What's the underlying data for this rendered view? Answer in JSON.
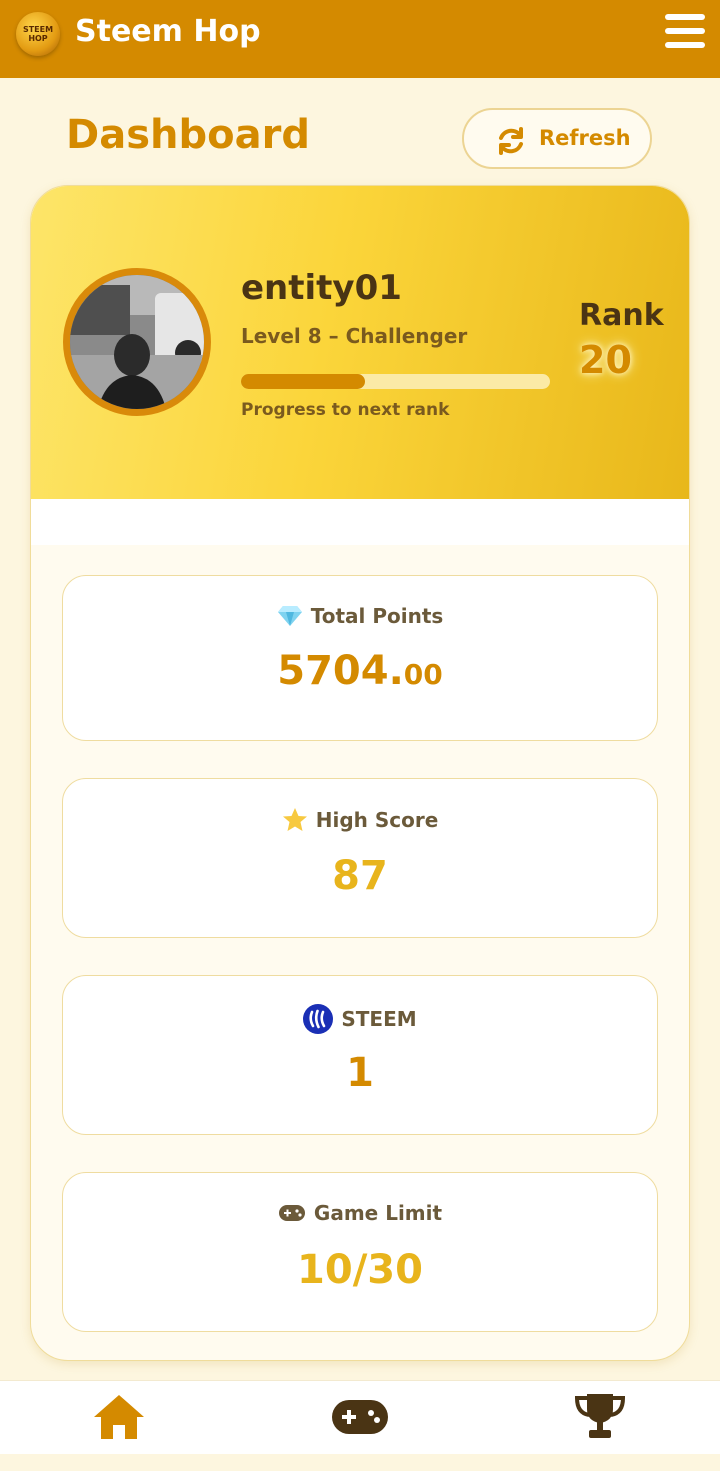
{
  "app": {
    "title": "Steem Hop",
    "logo_text": [
      "STEEM",
      "HOP"
    ]
  },
  "header": {
    "page_title": "Dashboard",
    "refresh_label": "Refresh"
  },
  "profile": {
    "username": "entity01",
    "level": "Level 8 – Challenger",
    "progress": 0.4,
    "progress_label": "Progress to next rank",
    "rank_label": "Rank",
    "rank_value": "20"
  },
  "stats": [
    {
      "label": "Total Points",
      "icon": "diamond-icon",
      "value": "5704.",
      "value_decimal": "00",
      "color": "#d48a00"
    },
    {
      "label": "High Score",
      "icon": "star-icon",
      "value": "87",
      "color": "#e8b41c"
    },
    {
      "label": "STEEM",
      "icon": "steem-icon",
      "value": "1",
      "color": "#d48a00"
    },
    {
      "label": "Game Limit",
      "icon": "gamepad-icon",
      "value": "10/30",
      "color": "#e8b41c"
    }
  ],
  "nav": {
    "items": [
      "home-icon",
      "gamepad-icon",
      "trophy-icon"
    ]
  },
  "colors": {
    "primary": "#d48a00",
    "accent": "#fbd53a",
    "background": "#fdf6df"
  }
}
